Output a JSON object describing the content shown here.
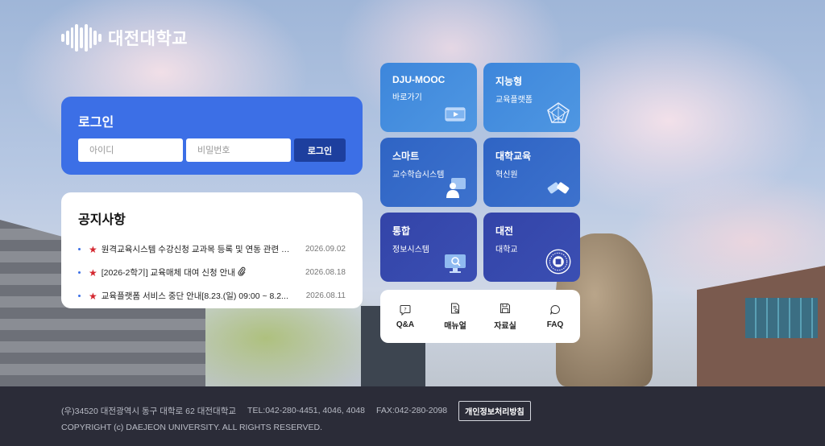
{
  "brand": {
    "name": "대전대학교",
    "logo_icon": "dju-logo-icon"
  },
  "login": {
    "title": "로그인",
    "id_placeholder": "아이디",
    "pw_placeholder": "비밀번호",
    "button": "로그인"
  },
  "notice": {
    "title": "공지사항",
    "items": [
      {
        "text": "원격교육시스템 수강신청 교과목 등록 및 연동 관련 안내",
        "date": "2026.09.02",
        "attachment": false
      },
      {
        "text": "[2026-2학기] 교육매체 대여 신청 안내",
        "date": "2026.08.18",
        "attachment": true
      },
      {
        "text": "교육플랫폼 서비스 중단 안내[8.23.(일) 09:00 ~ 8.2...",
        "date": "2026.08.11",
        "attachment": false
      }
    ]
  },
  "tiles": [
    {
      "title": "DJU-MOOC",
      "sub": "바로가기",
      "icon": "video-icon"
    },
    {
      "title": "지능형",
      "sub": "교육플랫폼",
      "icon": "pentagon-icon"
    },
    {
      "title": "스마트",
      "sub": "교수학습시스템",
      "icon": "teacher-icon"
    },
    {
      "title": "대학교육",
      "sub": "혁신원",
      "icon": "handshake-icon"
    },
    {
      "title": "통합",
      "sub": "정보시스템",
      "icon": "monitor-search-icon"
    },
    {
      "title": "대전",
      "sub": "대학교",
      "icon": "university-seal-icon"
    }
  ],
  "quick_links": [
    {
      "label": "Q&A",
      "icon": "question-bubble-icon"
    },
    {
      "label": "매뉴얼",
      "icon": "document-search-icon"
    },
    {
      "label": "자료실",
      "icon": "save-disk-icon"
    },
    {
      "label": "FAQ",
      "icon": "chat-icon"
    }
  ],
  "footer": {
    "address": "(우)34520 대전광역시 동구 대학로 62 대전대학교",
    "tel": "TEL:042-280-4451, 4046, 4048",
    "fax": "FAX:042-280-2098",
    "policy_button": "개인정보처리방침",
    "copyright": "COPYRIGHT (c) DAEJEON UNIVERSITY. ALL RIGHTS RESERVED."
  },
  "colors": {
    "accent": "#3c6fe6",
    "footer_bg": "#2b2c38",
    "star": "#d4272f"
  }
}
